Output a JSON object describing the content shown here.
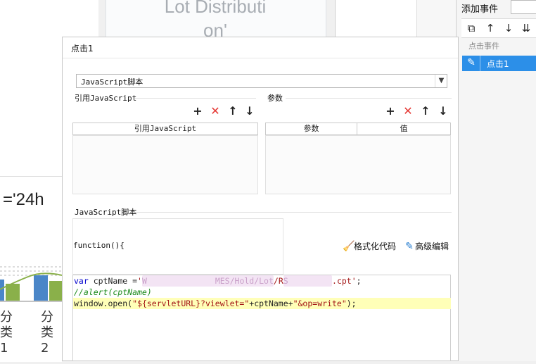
{
  "background": {
    "card_title_line1": "Lot Distributi",
    "card_title_line2": "on'",
    "expression_fragment": "='24h",
    "x_label_1": "分类1",
    "x_label_2": "分类2"
  },
  "right_panel": {
    "add_event_label": "添加事件",
    "toolbar": [
      {
        "name": "copy-icon",
        "glyph": "⧉"
      },
      {
        "name": "arrow-up-icon",
        "glyph": "↑"
      },
      {
        "name": "arrow-down-icon",
        "glyph": "↓"
      },
      {
        "name": "sort-icon",
        "glyph": "⇊"
      }
    ],
    "list_header": "点击事件",
    "list_item_label": "点击1"
  },
  "dialog": {
    "title": "点击1",
    "script_type": {
      "selected": "JavaScript脚本"
    },
    "ref_js": {
      "section_label": "引用JavaScript",
      "column_header": "引用JavaScript",
      "rows": []
    },
    "params": {
      "section_label": "参数",
      "columns": [
        "参数",
        "值"
      ],
      "rows": []
    },
    "script": {
      "section_label": "JavaScript脚本",
      "function_header": "function(){",
      "format_label": "格式化代码",
      "advanced_label": "高级编辑",
      "code_lines": [
        {
          "kw": "var",
          "text": " cptName =",
          "str_open": "'",
          "obscured_1": "W              MES/Hold/Lot",
          "str_mid": "/R",
          "obscured_2": "S         ",
          "str_close": ".cpt'",
          "end": ";"
        },
        {
          "comment": "//alert(cptName)"
        },
        {
          "fn": "window.open(",
          "s1": "\"${servletURL}?viewlet=\"",
          "mid": "+cptName+",
          "s2": "\"&op=write\"",
          "end": ");"
        }
      ]
    }
  },
  "colors": {
    "accent": "#2c8fe8",
    "delete_red": "#e53935",
    "highlight_line": "#ffffb8",
    "keyword_blue": "#0000cc",
    "string_red": "#a31515",
    "comment_green": "#1a8a1a"
  }
}
